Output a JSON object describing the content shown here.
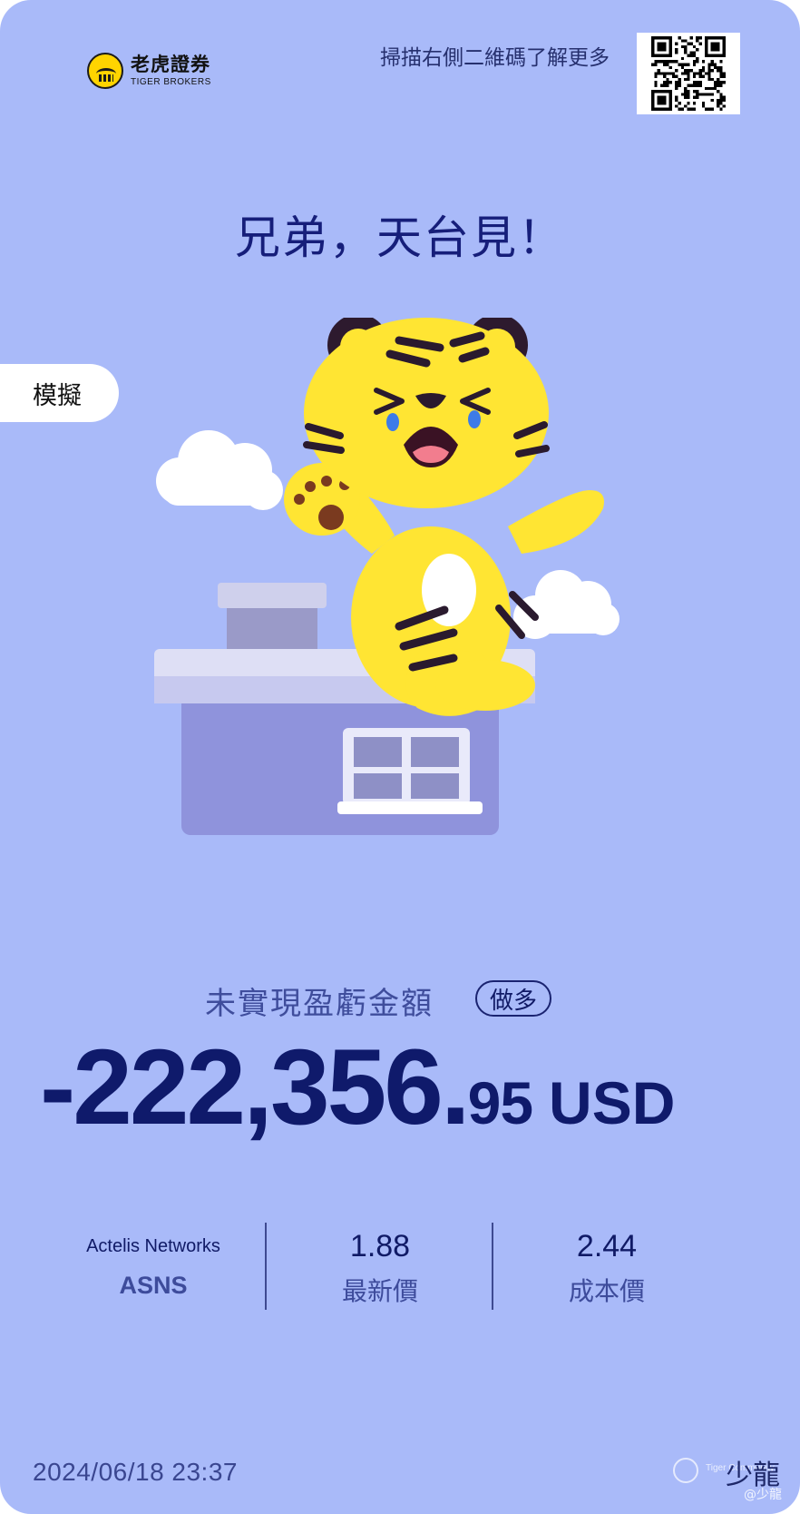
{
  "brand": {
    "name_cn": "老虎證券",
    "name_en": "TIGER BROKERS"
  },
  "header": {
    "scan_hint": "掃描右側二維碼了解更多"
  },
  "headline": "兄弟，天台見！",
  "mode_tag": "模擬",
  "pnl": {
    "label": "未實現盈虧金額",
    "position_badge": "做多",
    "amount_integer": "-222,356.",
    "amount_decimal": "95",
    "currency": "USD"
  },
  "stats": {
    "company_name": "Actelis Networks",
    "ticker": "ASNS",
    "last_price": "1.88",
    "last_price_label": "最新價",
    "cost_price": "2.44",
    "cost_price_label": "成本價"
  },
  "footer": {
    "timestamp": "2024/06/18 23:37",
    "watermark_name": "少龍",
    "watermark_small": "Tiger Community",
    "watermark_handle": "@少龍"
  },
  "colors": {
    "background": "#a9baf9",
    "primary_text": "#0f1a6b",
    "mascot_yellow": "#ffe533"
  }
}
